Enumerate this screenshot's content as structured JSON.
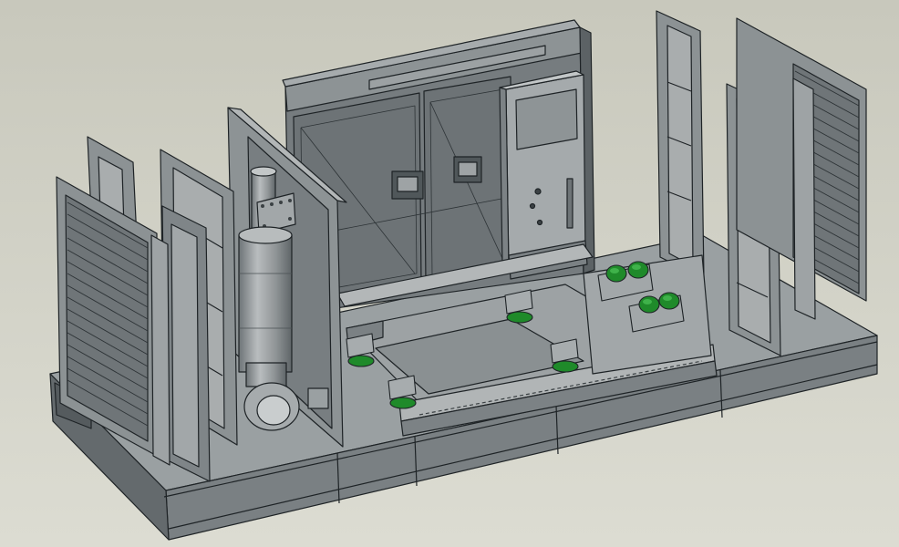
{
  "viewport": {
    "background_top": "#c8c8bc",
    "background_bottom": "#dcdcd2"
  },
  "palette": {
    "steel_light": "#a9adae",
    "steel_mid": "#8f9496",
    "steel_dark": "#6e7477",
    "steel_shadow": "#575d60",
    "edge": "#1e2326",
    "mount_green": "#1f8a2a",
    "mount_green_light": "#3fb24a"
  },
  "model": {
    "components": [
      "base-skid",
      "rear-wall",
      "rear-double-door",
      "control-cabinet",
      "left-louver-panel",
      "right-louver-panel",
      "left-frame-posts",
      "right-frame-posts",
      "exhaust-silencer",
      "side-partition-panel",
      "floor-cable-tray",
      "engine-mounts",
      "vibration-isolators"
    ]
  }
}
